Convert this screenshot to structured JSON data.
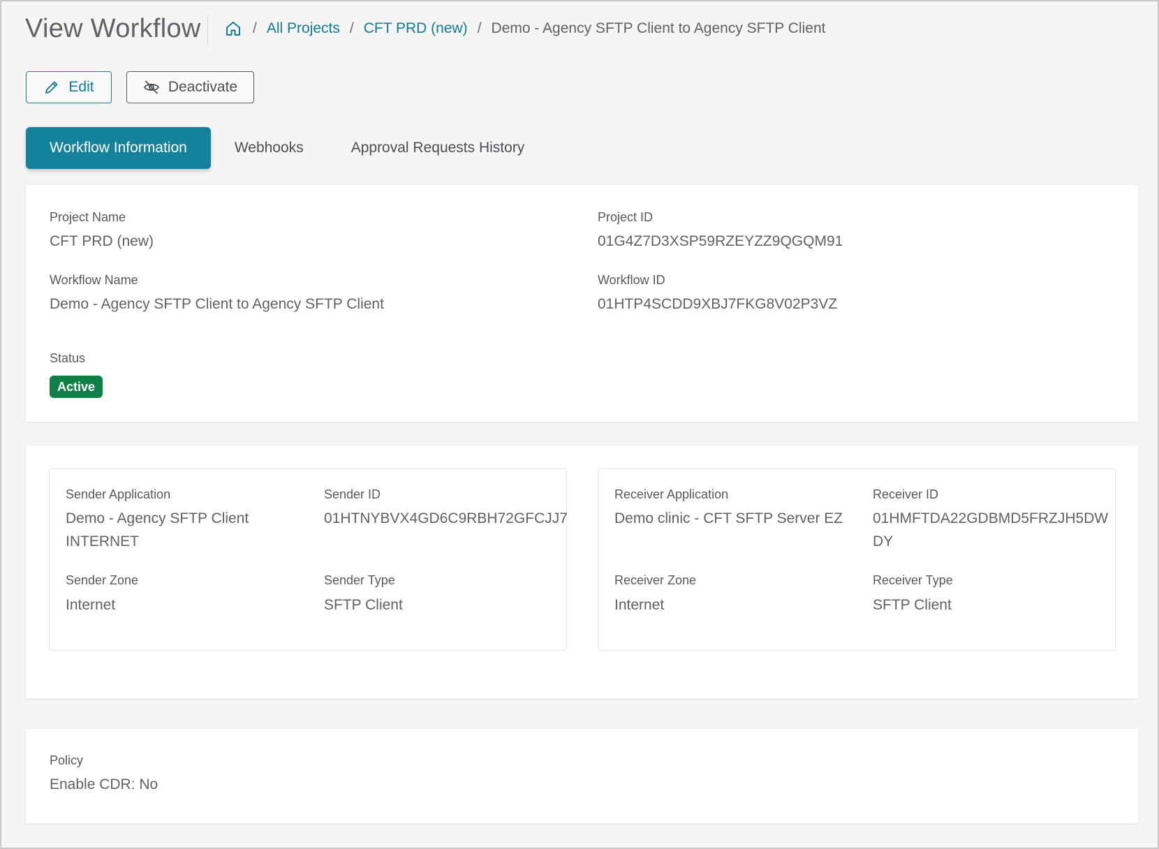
{
  "header": {
    "title": "View Workflow",
    "breadcrumb": {
      "separator": "/",
      "items": [
        "All Projects",
        "CFT PRD (new)"
      ],
      "current": "Demo - Agency SFTP Client to Agency SFTP Client"
    }
  },
  "actions": {
    "edit_label": "Edit",
    "deactivate_label": "Deactivate"
  },
  "tabs": [
    {
      "label": "Workflow Information",
      "active": true
    },
    {
      "label": "Webhooks",
      "active": false
    },
    {
      "label": "Approval Requests History",
      "active": false
    }
  ],
  "workflow_info": {
    "project_name_label": "Project Name",
    "project_name": "CFT PRD (new)",
    "project_id_label": "Project ID",
    "project_id": "01G4Z7D3XSP59RZEYZZ9QGQM91",
    "workflow_name_label": "Workflow Name",
    "workflow_name": "Demo - Agency SFTP Client to Agency SFTP Client",
    "workflow_id_label": "Workflow ID",
    "workflow_id": "01HTP4SCDD9XBJ7FKG8V02P3VZ",
    "status_label": "Status",
    "status": "Active"
  },
  "sender": {
    "application_label": "Sender Application",
    "application_line1": "Demo - Agency SFTP Client",
    "application_line2": "INTERNET",
    "id_label": "Sender ID",
    "id": "01HTNYBVX4GD6C9RBH72GFCJJ7",
    "zone_label": "Sender Zone",
    "zone": "Internet",
    "type_label": "Sender Type",
    "type": "SFTP Client"
  },
  "receiver": {
    "application_label": "Receiver Application",
    "application": "Demo clinic - CFT SFTP Server EZ",
    "id_label": "Receiver ID",
    "id_line1": "01HMFTDA22GDBMD5FRZJH5DW",
    "id_line2": "DY",
    "zone_label": "Receiver Zone",
    "zone": "Internet",
    "type_label": "Receiver Type",
    "type": "SFTP Client"
  },
  "policy": {
    "label": "Policy",
    "value": "Enable CDR: No"
  },
  "colors": {
    "accent": "#13829a",
    "link": "#0f7c93",
    "status_active": "#0e7f46"
  },
  "icons": {
    "home": "home-icon",
    "edit": "pencil-icon",
    "deactivate": "eye-off-icon"
  }
}
